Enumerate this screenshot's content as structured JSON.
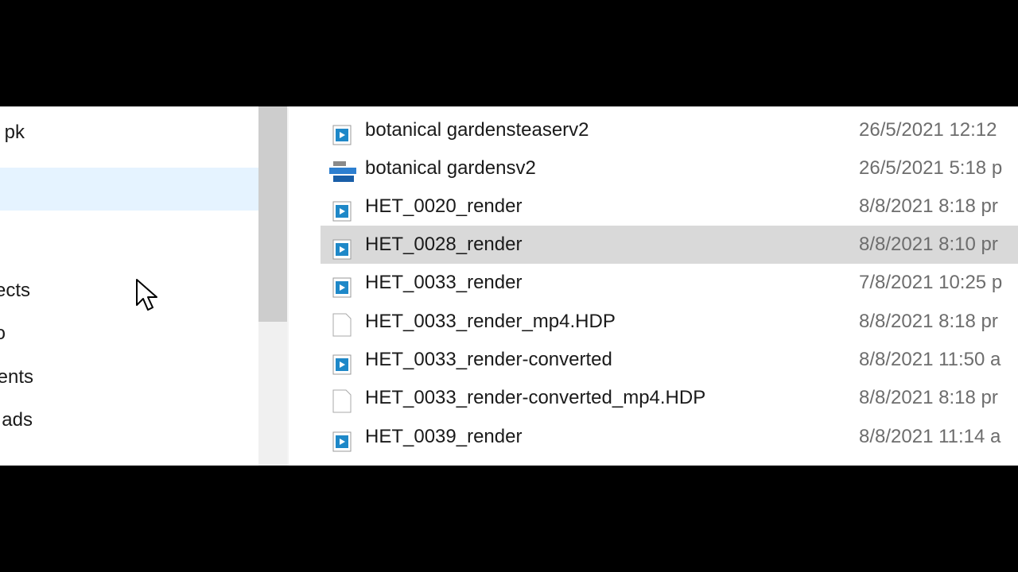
{
  "navigation": {
    "items": [
      {
        "label": "pk",
        "state": "normal"
      },
      {
        "label": "",
        "state": "hovered"
      },
      {
        "label": "ects",
        "state": "normal"
      },
      {
        "label": "o",
        "state": "normal"
      },
      {
        "label": "ents",
        "state": "normal"
      },
      {
        "label": "ads",
        "state": "normal"
      }
    ]
  },
  "files": [
    {
      "name": "botanical gardensteaserv2",
      "date": "26/5/2021 12:12",
      "icon": "media-file-icon"
    },
    {
      "name": "botanical gardensv2",
      "date": "26/5/2021 5:18 p",
      "icon": "project-file-icon"
    },
    {
      "name": "HET_0020_render",
      "date": "8/8/2021 8:18 pr",
      "icon": "media-file-icon"
    },
    {
      "name": "HET_0028_render",
      "date": "8/8/2021 8:10 pr",
      "icon": "media-file-icon",
      "selected": true
    },
    {
      "name": "HET_0033_render",
      "date": "7/8/2021 10:25 p",
      "icon": "media-file-icon"
    },
    {
      "name": "HET_0033_render_mp4.HDP",
      "date": "8/8/2021 8:18 pr",
      "icon": "blank-file-icon"
    },
    {
      "name": "HET_0033_render-converted",
      "date": "8/8/2021 11:50 a",
      "icon": "media-file-icon"
    },
    {
      "name": "HET_0033_render-converted_mp4.HDP",
      "date": "8/8/2021 8:18 pr",
      "icon": "blank-file-icon"
    },
    {
      "name": "HET_0039_render",
      "date": "8/8/2021 11:14 a",
      "icon": "media-file-icon"
    }
  ],
  "colors": {
    "hover": "#e5f3ff",
    "selected": "#d9d9d9",
    "media_icon": "#1e88c8"
  }
}
